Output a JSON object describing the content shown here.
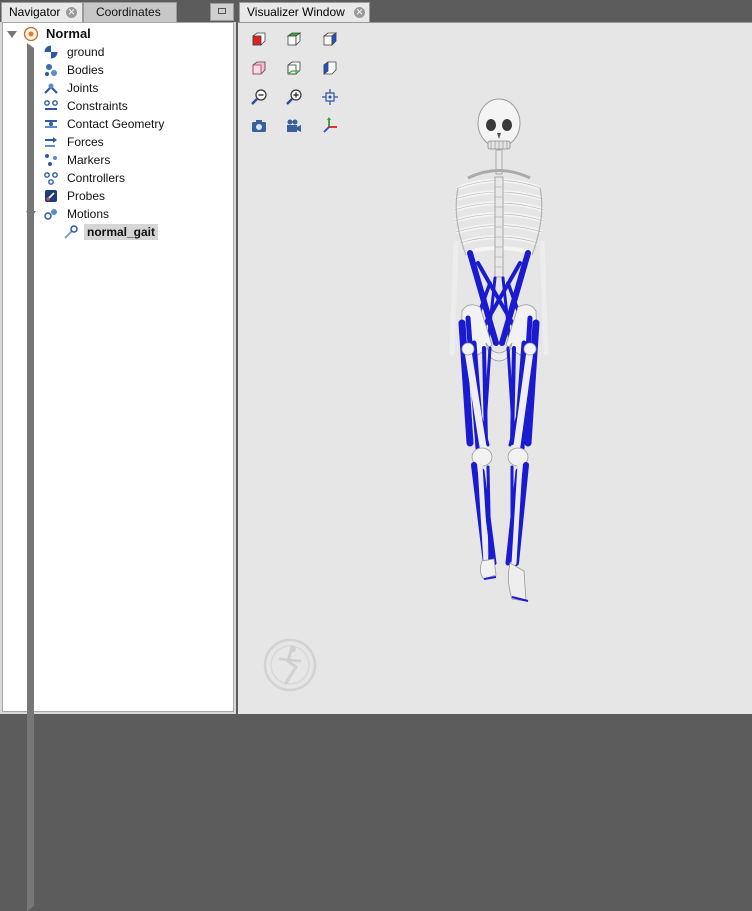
{
  "navigator_tabs": {
    "navigator": "Navigator",
    "coordinates": "Coordinates"
  },
  "visualizer_tab": {
    "title": "Visualizer Window"
  },
  "tree": {
    "root": "Normal",
    "items": {
      "ground": "ground",
      "bodies": "Bodies",
      "joints": "Joints",
      "constraints": "Constraints",
      "contact_geometry": "Contact Geometry",
      "forces": "Forces",
      "markers": "Markers",
      "controllers": "Controllers",
      "probes": "Probes",
      "motions": "Motions",
      "normal_gait": "normal_gait"
    }
  },
  "toolbar_icons": [
    "front-view-icon",
    "top-view-icon",
    "right-view-icon",
    "back-view-icon",
    "bottom-view-icon",
    "left-view-icon",
    "zoom-out-icon",
    "zoom-in-icon",
    "fit-view-icon",
    "snapshot-icon",
    "record-movie-icon",
    "axes-icon"
  ],
  "colors": {
    "muscle": "#1a1ad0",
    "bone": "#f2f2f2",
    "background": "#e6e6e6",
    "panel": "#d9d9d9"
  }
}
